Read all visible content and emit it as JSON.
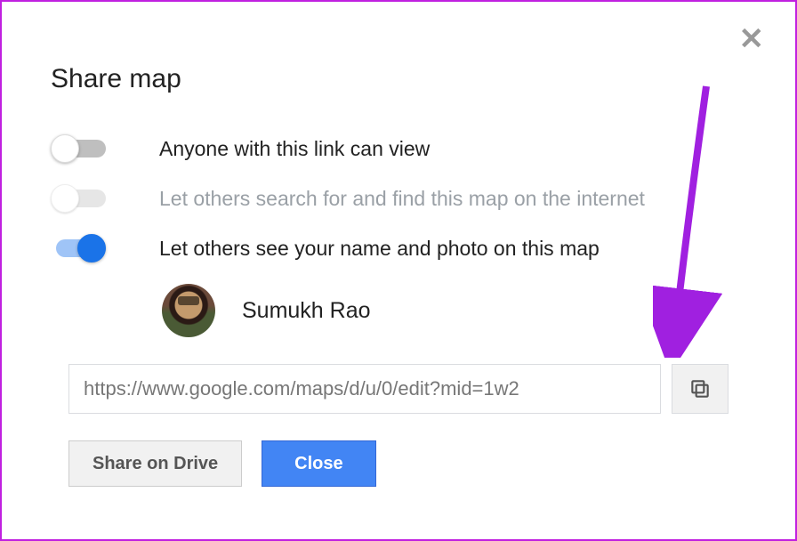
{
  "dialog": {
    "title": "Share map",
    "toggles": {
      "anyone_view": {
        "label": "Anyone with this link can view",
        "state": "off"
      },
      "searchable": {
        "label": "Let others search for and find this map on the internet",
        "state": "disabled"
      },
      "show_name": {
        "label": "Let others see your name and photo on this map",
        "state": "on"
      }
    },
    "user": {
      "name": "Sumukh Rao"
    },
    "share_link": "https://www.google.com/maps/d/u/0/edit?mid=1w2",
    "buttons": {
      "share_drive": "Share on Drive",
      "close": "Close"
    }
  }
}
